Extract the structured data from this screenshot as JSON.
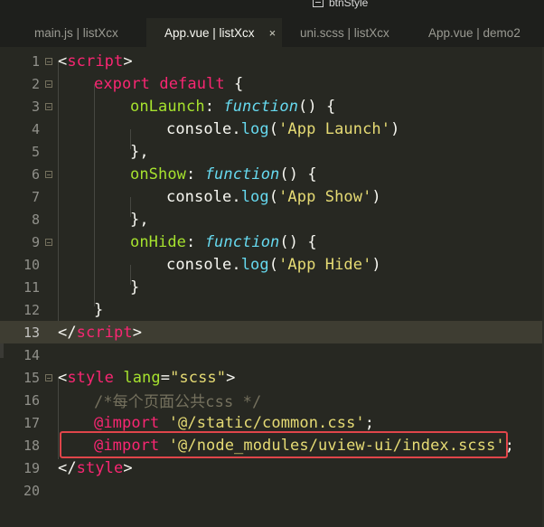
{
  "top_hint": {
    "icon": "symbol-icon",
    "text": "btnStyle"
  },
  "tabs": [
    {
      "label": "main.js | listXcx",
      "active": false,
      "closable": false
    },
    {
      "label": "App.vue | listXcx",
      "active": true,
      "closable": true
    },
    {
      "label": "uni.scss | listXcx",
      "active": false,
      "closable": false
    },
    {
      "label": "App.vue | demo2",
      "active": false,
      "closable": false
    }
  ],
  "tab_close_glyph": "×",
  "editor": {
    "highlighted_line": 13,
    "line_numbers": [
      "1",
      "2",
      "3",
      "4",
      "5",
      "6",
      "7",
      "8",
      "9",
      "10",
      "11",
      "12",
      "13",
      "14",
      "15",
      "16",
      "17",
      "18",
      "19",
      "20"
    ],
    "annotated_line": 18,
    "annotation_color": "#e0454a",
    "lines": {
      "l1": {
        "lt": "<",
        "tag": "script",
        "gt": ">"
      },
      "l2": {
        "kw1": "export",
        "sp": " ",
        "kw2": "default",
        "brace": " {"
      },
      "l3": {
        "name": "onLaunch",
        "colon": ": ",
        "fn": "function",
        "rest": "() {"
      },
      "l4": {
        "obj": "console",
        "dot": ".",
        "method": "log",
        "open": "(",
        "str": "'App Launch'",
        "close": ")"
      },
      "l5": {
        "text": "},"
      },
      "l6": {
        "name": "onShow",
        "colon": ": ",
        "fn": "function",
        "rest": "() {"
      },
      "l7": {
        "obj": "console",
        "dot": ".",
        "method": "log",
        "open": "(",
        "str": "'App Show'",
        "close": ")"
      },
      "l8": {
        "text": "},"
      },
      "l9": {
        "name": "onHide",
        "colon": ": ",
        "fn": "function",
        "rest": "() {"
      },
      "l10": {
        "obj": "console",
        "dot": ".",
        "method": "log",
        "open": "(",
        "str": "'App Hide'",
        "close": ")"
      },
      "l11": {
        "text": "}"
      },
      "l12": {
        "text": "}"
      },
      "l13": {
        "lt": "</",
        "tag": "script",
        "gt": ">"
      },
      "l14": {},
      "l15": {
        "lt": "<",
        "tag": "style",
        "sp": " ",
        "attr": "lang",
        "eq": "=",
        "val": "\"scss\"",
        "gt": ">"
      },
      "l16": {
        "comment": "/*每个页面公共css */"
      },
      "l17": {
        "at": "@import",
        "sp": " ",
        "str": "'@/static/common.css'",
        "semi": ";"
      },
      "l18": {
        "at": "@import",
        "sp": " ",
        "str": "'@/node_modules/uview-ui/index.scss'",
        "semi": ";"
      },
      "l19": {
        "lt": "</",
        "tag": "style",
        "gt": ">"
      },
      "l20": {}
    }
  }
}
